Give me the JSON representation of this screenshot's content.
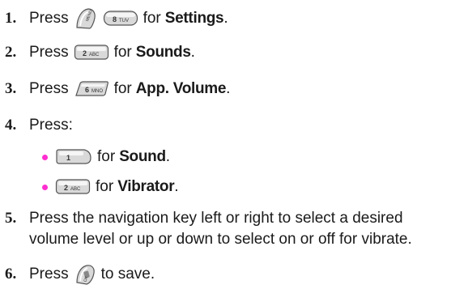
{
  "steps": [
    {
      "num": "1.",
      "pre": "Press",
      "post": "for",
      "bold": "Settings",
      "end": "."
    },
    {
      "num": "2.",
      "pre": "Press",
      "post": "for",
      "bold": "Sounds",
      "end": "."
    },
    {
      "num": "3.",
      "pre": "Press",
      "post": "for",
      "bold": "App. Volume",
      "end": "."
    },
    {
      "num": "4.",
      "pre": "Press:"
    },
    {
      "num": "5.",
      "line1": "Press the navigation key left or right to select a desired",
      "line2": "volume level or up or down to select on or off for vibrate."
    },
    {
      "num": "6.",
      "pre": "Press",
      "post": "to save."
    }
  ],
  "bullets": [
    {
      "post": "for",
      "bold": "Sound",
      "end": "."
    },
    {
      "post": "for",
      "bold": "Vibrator",
      "end": "."
    }
  ],
  "keys": {
    "menu": "MENU",
    "eight_digit": "8",
    "eight_letters": "TUV",
    "two_digit": "2",
    "two_letters": "ABC",
    "six_digit": "6",
    "six_letters": "MNO",
    "one_digit": "1",
    "ok": "OK"
  },
  "colors": {
    "bullet": "#ff2fd0",
    "key_fill": "#d9d9d9",
    "key_stroke": "#555555"
  }
}
